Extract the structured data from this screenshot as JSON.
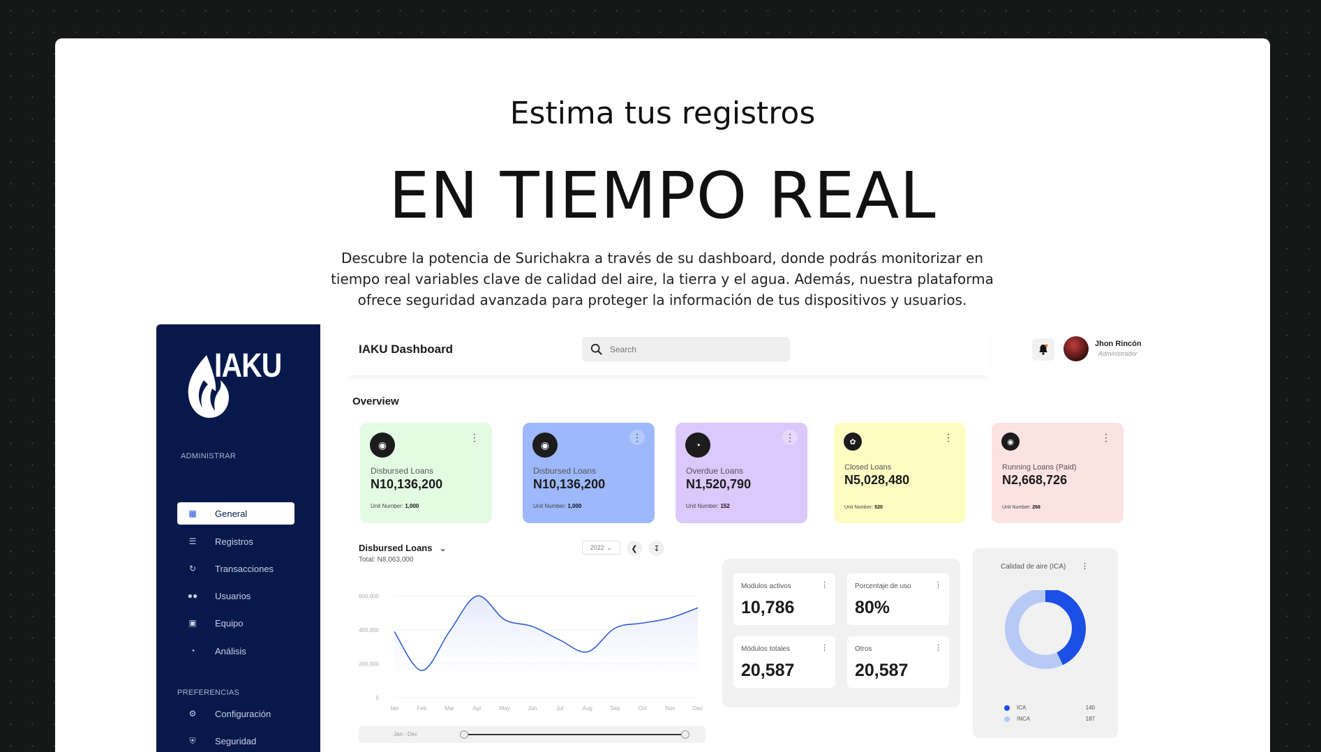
{
  "hero": {
    "subtitle": "Estima tus registros",
    "title": "EN TIEMPO REAL",
    "description": "Descubre la potencia de Surichakra a través de su dashboard, donde podrás monitorizar en tiempo real variables clave de calidad del aire, la tierra y el agua. Además, nuestra plataforma ofrece seguridad avanzada para proteger la información de tus dispositivos y usuarios."
  },
  "sidebar": {
    "logo_text": "IAKU",
    "section_admin": "ADMINISTRAR",
    "section_prefs": "PREFERENCIAS",
    "items": [
      {
        "label": "General",
        "icon": "dashboard-icon",
        "active": true
      },
      {
        "label": "Registros",
        "icon": "list-icon"
      },
      {
        "label": "Transacciones",
        "icon": "refresh-icon"
      },
      {
        "label": "Usuarios",
        "icon": "users-icon"
      },
      {
        "label": "Equipo",
        "icon": "id-card-icon"
      },
      {
        "label": "Análisis",
        "icon": "pie-chart-icon"
      }
    ],
    "pref_items": [
      {
        "label": "Configuración",
        "icon": "gear-icon"
      },
      {
        "label": "Seguridad",
        "icon": "shield-icon"
      }
    ]
  },
  "topbar": {
    "title": "IAKU Dashboard",
    "search_placeholder": "Search",
    "user_name": "Jhon Rincón",
    "user_role": "Administrador"
  },
  "overview": {
    "title": "Overview",
    "cards": [
      {
        "label": "Disbursed Loans",
        "value": "N10,136,200",
        "unit_label": "Unit Number:",
        "unit_value": "1,000",
        "color": "#e3fbe3"
      },
      {
        "label": "Disbursed Loans",
        "value": "N10,136,200",
        "unit_label": "Unit Number:",
        "unit_value": "1,000",
        "color": "#9db8fb"
      },
      {
        "label": "Overdue Loans",
        "value": "N1,520,790",
        "unit_label": "Unit Number:",
        "unit_value": "152",
        "color": "#dcc8fb"
      },
      {
        "label": "Closed Loans",
        "value": "N5,028,480",
        "unit_label": "Unit Number:",
        "unit_value": "520",
        "color": "#fefcc2"
      },
      {
        "label": "Running Loans (Paid)",
        "value": "N2,668,726",
        "unit_label": "Unit Number:",
        "unit_value": "266",
        "color": "#fde2e2"
      }
    ]
  },
  "chart_panel": {
    "title": "Disbursed Loans",
    "total": "Total: N8,063,000",
    "year": "2022",
    "range_label": "Jan - Dec"
  },
  "chart_data": {
    "type": "area",
    "categories": [
      "Jan",
      "Feb",
      "Mar",
      "Apr",
      "May",
      "Jun",
      "Jul",
      "Aug",
      "Sep",
      "Oct",
      "Nov",
      "Dec"
    ],
    "series": [
      {
        "values": [
          390000,
          160000,
          390000,
          600000,
          460000,
          420000,
          340000,
          270000,
          410000,
          440000,
          470000,
          530000
        ]
      }
    ],
    "ylim": [
      0,
      700000
    ],
    "yticks": [
      "0",
      "200,000",
      "400,000",
      "600,000"
    ],
    "colors": {
      "line": "#2f5fd3",
      "fill_top": "#dfe6fb"
    }
  },
  "metrics": [
    {
      "label": "Modulos activos",
      "value": "10,786"
    },
    {
      "label": "Porcentaje de uso",
      "value": "80%"
    },
    {
      "label": "Módulos totales",
      "value": "20,587"
    },
    {
      "label": "Otros",
      "value": "20,587"
    }
  ],
  "air_quality": {
    "title": "Calidad de aire (ICA)",
    "legend": [
      {
        "name": "ICA",
        "value": "140",
        "color": "#1c4fe6"
      },
      {
        "name": "INCA",
        "value": "187",
        "color": "#b7c9f5"
      }
    ]
  }
}
